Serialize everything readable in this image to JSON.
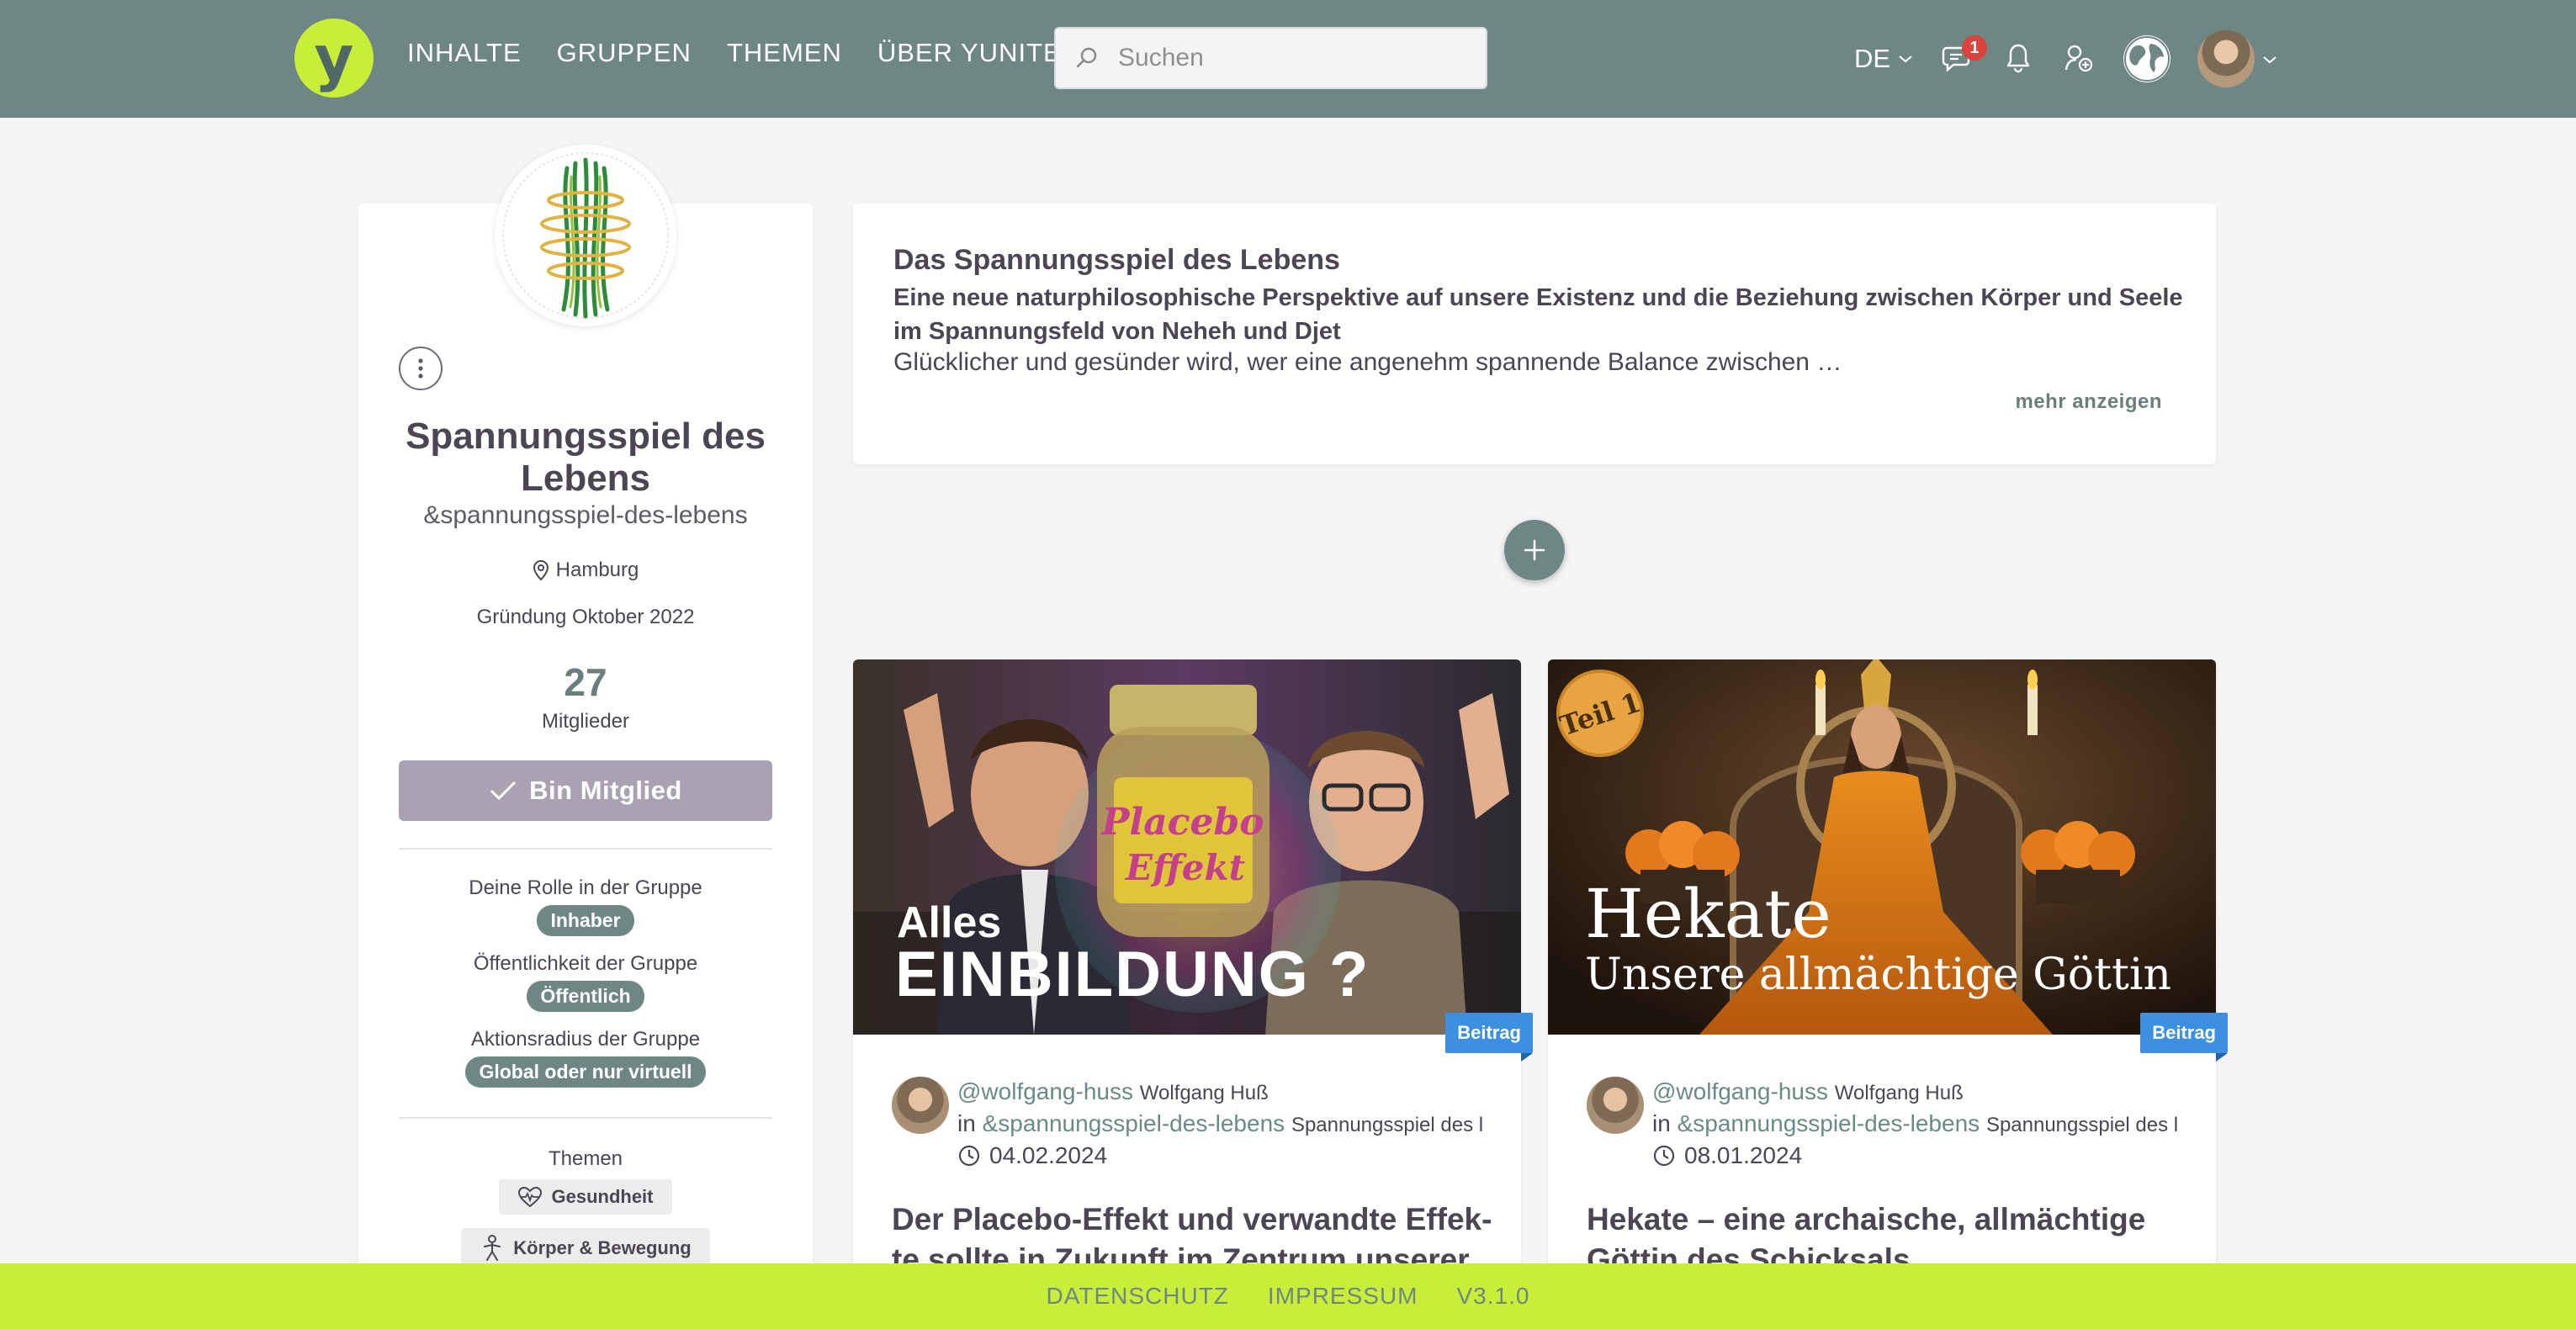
{
  "header": {
    "logo_letter": "y",
    "nav": [
      "INHALTE",
      "GRUPPEN",
      "THEMEN",
      "ÜBER YUNITE"
    ],
    "search_placeholder": "Suchen",
    "language": "DE",
    "chat_badge_count": "1"
  },
  "group": {
    "name": "Spannungsspiel des Lebens",
    "slug": "&spannungsspiel-des-lebens",
    "location": "Hamburg",
    "founded": "Gründung Oktober 2022",
    "member_count": "27",
    "member_label": "Mitglieder",
    "member_button": "Bin Mitglied",
    "role_label": "Deine Rolle in der Gruppe",
    "role_value": "Inhaber",
    "visibility_label": "Öffentlichkeit der Gruppe",
    "visibility_value": "Öffentlich",
    "radius_label": "Aktionsradius der Gruppe",
    "radius_value": "Global oder nur virtuell",
    "topics_label": "Themen",
    "topics": [
      "Gesundheit",
      "Körper & Bewegung"
    ]
  },
  "description": {
    "title": "Das Spannungsspiel des Lebens",
    "subtitle": "Eine neue naturphilosophische Perspektive auf unsere Existenz und die Beziehung zwischen Körper und Seele im Spannungsfeld von Neheh und Djet",
    "text": "Glücklicher und gesünder wird, wer eine angenehm spannende Balance zwischen …",
    "more": "mehr anzeigen"
  },
  "posts": [
    {
      "image_line1": "Alles",
      "image_line2": "EINBILDUNG ?",
      "jar_line1": "Placebo",
      "jar_line2": "Effekt",
      "type": "Beitrag",
      "author_handle": "@wolfgang-huss",
      "author_name": "Wolfgang Huß",
      "in_prefix": "in",
      "group_slug": "&spannungsspiel-des-lebens",
      "group_name": "Spannungsspiel des l",
      "date": "04.02.2024",
      "title": "Der Placebo-Effekt und verwandte Effek-te sollte in Zukunft im Zentrum unserer"
    },
    {
      "image_line1": "Hekate",
      "image_line2": "Unsere allmächtige Göttin",
      "badge_text": "Teil 1",
      "type": "Beitrag",
      "author_handle": "@wolfgang-huss",
      "author_name": "Wolfgang Huß",
      "in_prefix": "in",
      "group_slug": "&spannungsspiel-des-lebens",
      "group_name": "Spannungsspiel des l",
      "date": "08.01.2024",
      "title": "Hekate – eine archaische, allmächtige Göttin des Schicksals"
    }
  ],
  "footer": [
    "DATENSCHUTZ",
    "IMPRESSUM",
    "V3.1.0"
  ],
  "colors": {
    "header_bg": "#6e8784",
    "accent_lime": "#c9ee3a",
    "badge_red": "#d9443c",
    "beitrag_blue": "#3d8fe0"
  }
}
